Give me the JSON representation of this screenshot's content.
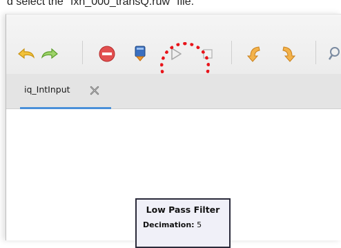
{
  "caption": {
    "text": "d select the \"fxn_000_transQ.ruw\" file."
  },
  "toolbar": {
    "buttons": [
      {
        "id": "undo",
        "icon": "undo-icon"
      },
      {
        "id": "redo",
        "icon": "redo-icon"
      },
      {
        "id": "kill",
        "icon": "stop-red-icon"
      },
      {
        "id": "generate",
        "icon": "generate-flowgraph-icon"
      },
      {
        "id": "execute",
        "icon": "play-icon",
        "enabled": false,
        "highlighted": true
      },
      {
        "id": "stop",
        "icon": "stop-square-icon",
        "enabled": false
      },
      {
        "id": "rotate-ccw",
        "icon": "rotate-ccw-icon"
      },
      {
        "id": "rotate-cw",
        "icon": "rotate-cw-icon"
      },
      {
        "id": "find",
        "icon": "search-icon"
      }
    ]
  },
  "tabs": [
    {
      "label": "iq_IntInput",
      "active": true,
      "close_icon": "close-icon"
    }
  ],
  "canvas": {
    "blocks": [
      {
        "title": "Low Pass Filter",
        "param_name": "Decimation:",
        "param_value": "5"
      }
    ]
  },
  "annotation": {
    "shape": "dotted-circle",
    "color": "#e8141a",
    "target": "execute"
  }
}
